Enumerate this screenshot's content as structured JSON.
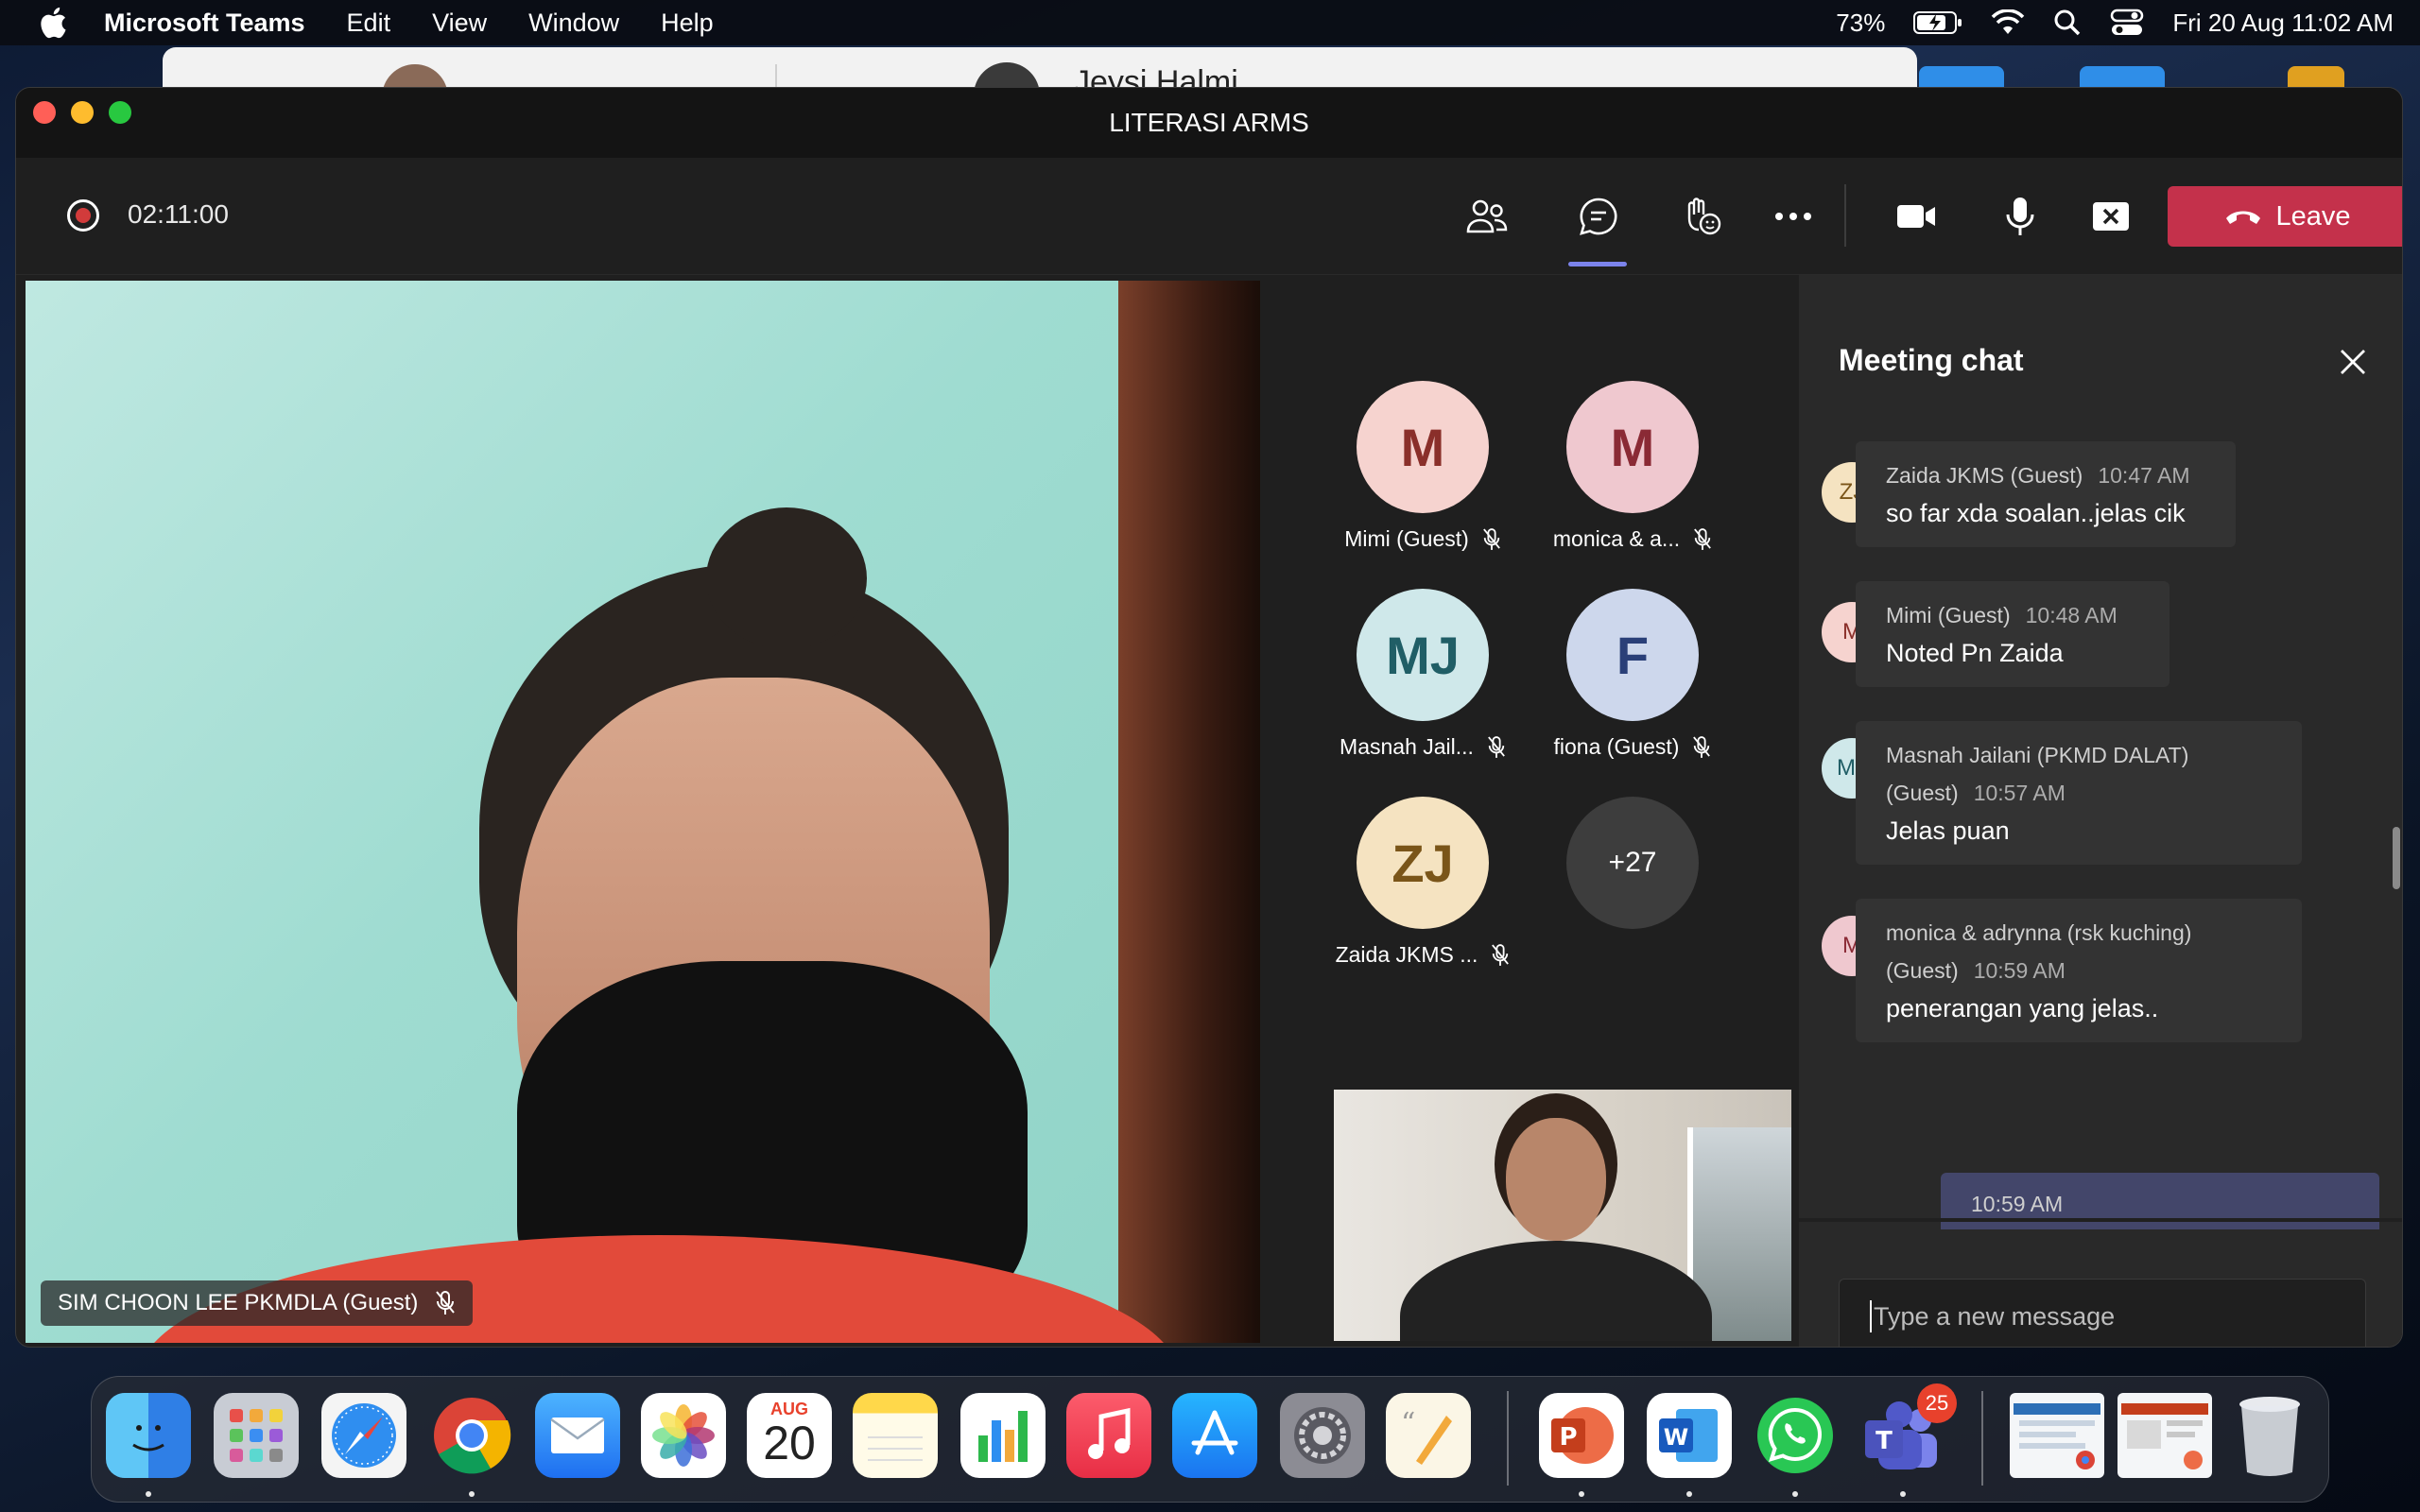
{
  "menubar": {
    "app_name": "Microsoft Teams",
    "menus": [
      "Edit",
      "View",
      "Window",
      "Help"
    ],
    "battery": "73%",
    "datetime": "Fri 20 Aug  11:02 AM"
  },
  "background_window": {
    "contact_name": "Jeysi Halmi"
  },
  "window": {
    "title": "LITERASI ARMS"
  },
  "toolbar": {
    "recording_timer": "02:11:00",
    "leave_label": "Leave"
  },
  "main_video": {
    "name": "SIM CHOON LEE PKMDLA (Guest)"
  },
  "participants": [
    {
      "initials": "M",
      "label": "Mimi (Guest)",
      "bg": "#f6d3cf",
      "fg": "#8a2f2a"
    },
    {
      "initials": "M",
      "label": "monica & a...",
      "bg": "#efc8cf",
      "fg": "#8a2a35"
    },
    {
      "initials": "MJ",
      "label": "Masnah Jail...",
      "bg": "#cfe8ea",
      "fg": "#205e66"
    },
    {
      "initials": "F",
      "label": "fiona (Guest)",
      "bg": "#cdd7ec",
      "fg": "#2a3f78"
    },
    {
      "initials": "ZJ",
      "label": "Zaida JKMS ...",
      "bg": "#f5e3c1",
      "fg": "#7a5519"
    }
  ],
  "overflow_count": "+27",
  "chat": {
    "title": "Meeting chat",
    "messages": [
      {
        "initials": "ZJ",
        "sender": "Zaida JKMS (Guest)",
        "time": "10:47 AM",
        "text": "so far xda soalan..jelas cik",
        "bg": "#f5e3c1",
        "fg": "#7a5519"
      },
      {
        "initials": "M",
        "sender": "Mimi (Guest)",
        "time": "10:48 AM",
        "text": "Noted Pn Zaida",
        "bg": "#f6d3cf",
        "fg": "#8a2f2a"
      },
      {
        "initials": "MJ",
        "sender": "Masnah Jailani (PKMD DALAT)",
        "sender2": "(Guest)",
        "time": "10:57 AM",
        "text": "Jelas puan",
        "bg": "#cfe8ea",
        "fg": "#205e66"
      },
      {
        "initials": "M",
        "sender": "monica & adrynna (rsk kuching)",
        "sender2": "(Guest)",
        "time": "10:59 AM",
        "text": "penerangan yang jelas..",
        "bg": "#efc8cf",
        "fg": "#8a2a35"
      }
    ],
    "own_message_time": "10:59 AM",
    "compose_placeholder": "Type a new message"
  },
  "dock": {
    "calendar_month": "AUG",
    "calendar_day": "20",
    "teams_badge": "25",
    "word_letter": "W",
    "ppt_letter": "P",
    "teams_letter": "T"
  },
  "colors": {
    "accent": "#7b83eb",
    "leave_red": "#c4314b",
    "recording_red": "#d23b3b"
  }
}
